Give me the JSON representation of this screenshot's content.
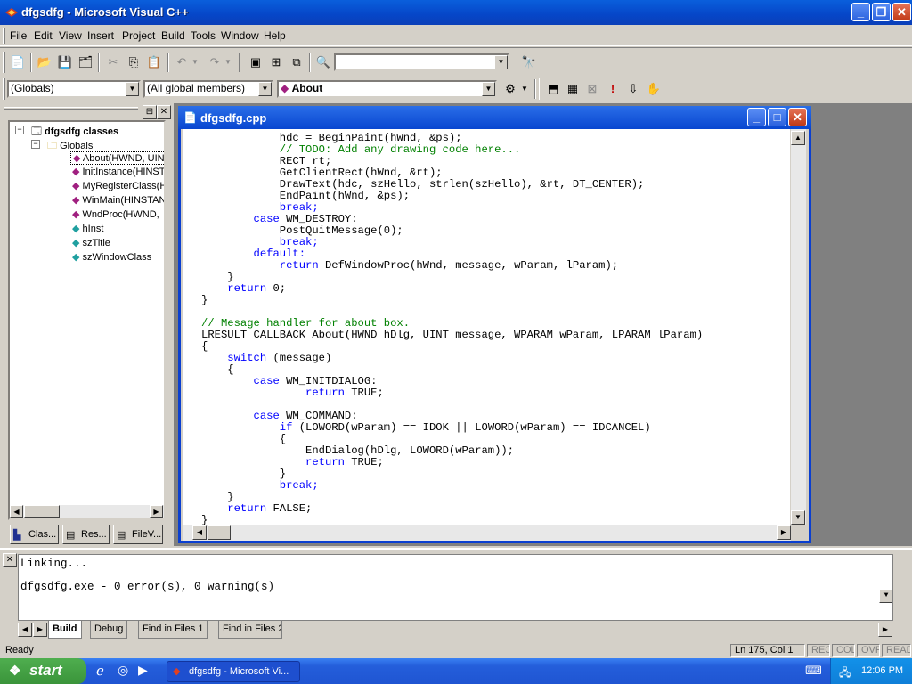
{
  "window": {
    "title": "dfgsdfg - Microsoft Visual C++"
  },
  "menu": [
    "File",
    "Edit",
    "View",
    "Insert",
    "Project",
    "Build",
    "Tools",
    "Window",
    "Help"
  ],
  "toolbar": {
    "find_combo_value": "",
    "scope_combo": "(Globals)",
    "members_combo": "(All global members)",
    "function_combo": "About"
  },
  "workspace": {
    "root": "dfgsdfg classes",
    "folder": "Globals",
    "items": [
      {
        "label": "About(HWND, UIN",
        "kind": "function"
      },
      {
        "label": "InitInstance(HINST",
        "kind": "function"
      },
      {
        "label": "MyRegisterClass(H",
        "kind": "function"
      },
      {
        "label": "WinMain(HINSTAN",
        "kind": "function"
      },
      {
        "label": "WndProc(HWND,",
        "kind": "function"
      },
      {
        "label": "hInst",
        "kind": "variable"
      },
      {
        "label": "szTitle",
        "kind": "variable"
      },
      {
        "label": "szWindowClass",
        "kind": "variable"
      }
    ],
    "tabs": [
      "Clas...",
      "Res...",
      "FileV..."
    ]
  },
  "editor": {
    "title": "dfgsdfg.cpp",
    "lines": [
      {
        "text": "            hdc = BeginPaint(hWnd, &ps);",
        "style": ""
      },
      {
        "text": "            // TODO: Add any drawing code here...",
        "style": "c"
      },
      {
        "text": "            RECT rt;",
        "style": ""
      },
      {
        "text": "            GetClientRect(hWnd, &rt);",
        "style": ""
      },
      {
        "text": "            DrawText(hdc, szHello, strlen(szHello), &rt, DT_CENTER);",
        "style": ""
      },
      {
        "text": "            EndPaint(hWnd, &ps);",
        "style": ""
      },
      {
        "text": "            break;",
        "style": "k"
      },
      {
        "text": "        case WM_DESTROY:",
        "style": "case"
      },
      {
        "text": "            PostQuitMessage(0);",
        "style": ""
      },
      {
        "text": "            break;",
        "style": "k"
      },
      {
        "text": "        default:",
        "style": "k"
      },
      {
        "text": "            return DefWindowProc(hWnd, message, wParam, lParam);",
        "style": "ret"
      },
      {
        "text": "    }",
        "style": ""
      },
      {
        "text": "    return 0;",
        "style": "ret"
      },
      {
        "text": "}",
        "style": ""
      },
      {
        "text": "",
        "style": ""
      },
      {
        "text": "// Mesage handler for about box.",
        "style": "c"
      },
      {
        "text": "LRESULT CALLBACK About(HWND hDlg, UINT message, WPARAM wParam, LPARAM lParam)",
        "style": ""
      },
      {
        "text": "{",
        "style": ""
      },
      {
        "text": "    switch (message)",
        "style": "switch"
      },
      {
        "text": "    {",
        "style": ""
      },
      {
        "text": "        case WM_INITDIALOG:",
        "style": "case"
      },
      {
        "text": "                return TRUE;",
        "style": "ret"
      },
      {
        "text": "",
        "style": ""
      },
      {
        "text": "        case WM_COMMAND:",
        "style": "case"
      },
      {
        "text": "            if (LOWORD(wParam) == IDOK || LOWORD(wParam) == IDCANCEL)",
        "style": "if"
      },
      {
        "text": "            {",
        "style": ""
      },
      {
        "text": "                EndDialog(hDlg, LOWORD(wParam));",
        "style": ""
      },
      {
        "text": "                return TRUE;",
        "style": "ret"
      },
      {
        "text": "            }",
        "style": ""
      },
      {
        "text": "            break;",
        "style": "k"
      },
      {
        "text": "    }",
        "style": ""
      },
      {
        "text": "    return FALSE;",
        "style": "ret"
      },
      {
        "text": "}",
        "style": ""
      }
    ]
  },
  "output": {
    "lines": [
      "Linking...",
      "",
      "dfgsdfg.exe - 0 error(s), 0 warning(s)"
    ],
    "tabs": [
      "Build",
      "Debug",
      "Find in Files 1",
      "Find in Files 2"
    ]
  },
  "status": {
    "text": "Ready",
    "position": "Ln 175, Col 1",
    "indicators": [
      "REC",
      "COL",
      "OVR",
      "READ"
    ]
  },
  "taskbar": {
    "start_label": "start",
    "task_label": "dfgsdfg - Microsoft Vi...",
    "clock": "12:06 PM"
  }
}
